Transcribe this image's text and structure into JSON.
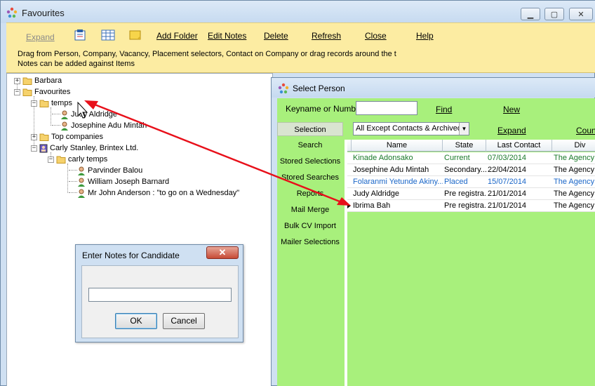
{
  "window": {
    "title": "Favourites",
    "controls": {
      "minimize": "▁",
      "maximize": "▢",
      "close": "✕"
    }
  },
  "toolbar": {
    "expand": "Expand",
    "icons": [
      "clipboard-icon",
      "grid-icon",
      "note-icon"
    ],
    "add_folder": "Add Folder",
    "edit_notes": "Edit Notes",
    "delete": "Delete",
    "refresh": "Refresh",
    "close": "Close",
    "help": "Help",
    "message_line1": "Drag from Person, Company, Vacancy, Placement selectors, Contact on Company or drag records around the t",
    "message_line2": "Notes can be added against Items"
  },
  "tree": {
    "barbara": "Barbara",
    "favourites": "Favourites",
    "temps": "temps",
    "judy": "Judy Aldridge",
    "josephine": "Josephine Adu Mintah",
    "top_companies": "Top companies",
    "carly": "Carly Stanley, Brintex Ltd.",
    "carly_temps": "carly temps",
    "parvinder": "Parvinder Balou",
    "william": "William Joseph Barnard",
    "anderson": "Mr John Anderson : \"to go on a Wednesday\""
  },
  "select_person": {
    "title": "Select Person",
    "keyname_label": "Keyname or Number",
    "keyname_value": "",
    "find": "Find",
    "new": "New",
    "filter": "All Except Contacts & Archived",
    "expand": "Expand",
    "count": "Count",
    "side_menu": [
      "Selection",
      "Search",
      "Stored Selections",
      "Stored Searches",
      "Reports",
      "Mail Merge",
      "Bulk CV Import",
      "Mailer Selections"
    ],
    "columns": [
      "Name",
      "State",
      "Last Contact",
      "Div"
    ],
    "rows": [
      {
        "name": "Kinade Adonsako",
        "state": "Current",
        "last_contact": "07/03/2014",
        "div": "The Agency",
        "color": "#1a7a2a"
      },
      {
        "name": "Josephine Adu Mintah",
        "state": "Secondary...",
        "last_contact": "22/04/2014",
        "div": "The Agency",
        "color": "#000000"
      },
      {
        "name": "Folaranmi Yetunde Akiny...",
        "state": "Placed",
        "last_contact": "15/07/2014",
        "div": "The Agency",
        "color": "#1a66c8"
      },
      {
        "name": "Judy Aldridge",
        "state": "Pre registra...",
        "last_contact": "21/01/2014",
        "div": "The Agency",
        "color": "#000000"
      },
      {
        "name": "Ibrima Bah",
        "state": "Pre registra...",
        "last_contact": "21/01/2014",
        "div": "The Agency",
        "color": "#000000"
      }
    ]
  },
  "dialog": {
    "title": "Enter Notes for Candidate",
    "close": "✕",
    "input_value": "",
    "ok": "OK",
    "cancel": "Cancel"
  }
}
